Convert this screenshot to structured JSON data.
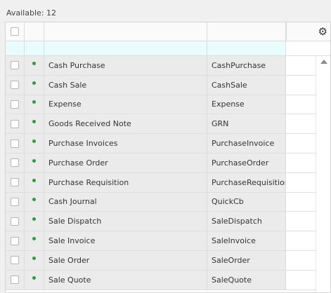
{
  "available_label": "Available: 12",
  "status_color": "#2e9e3a",
  "header": {
    "settings_icon": "gear-icon"
  },
  "rows": [
    {
      "name": "Cash Purchase",
      "code": "CashPurchase"
    },
    {
      "name": "Cash Sale",
      "code": "CashSale"
    },
    {
      "name": "Expense",
      "code": "Expense"
    },
    {
      "name": "Goods Received Note",
      "code": "GRN"
    },
    {
      "name": "Purchase Invoices",
      "code": "PurchaseInvoice"
    },
    {
      "name": "Purchase Order",
      "code": "PurchaseOrder"
    },
    {
      "name": "Purchase Requisition",
      "code": "PurchaseRequisition"
    },
    {
      "name": "Cash Journal",
      "code": "QuickCb"
    },
    {
      "name": "Sale Dispatch",
      "code": "SaleDispatch"
    },
    {
      "name": "Sale Invoice",
      "code": "SaleInvoice"
    },
    {
      "name": "Sale Order",
      "code": "SaleOrder"
    },
    {
      "name": "Sale Quote",
      "code": "SaleQuote"
    }
  ]
}
